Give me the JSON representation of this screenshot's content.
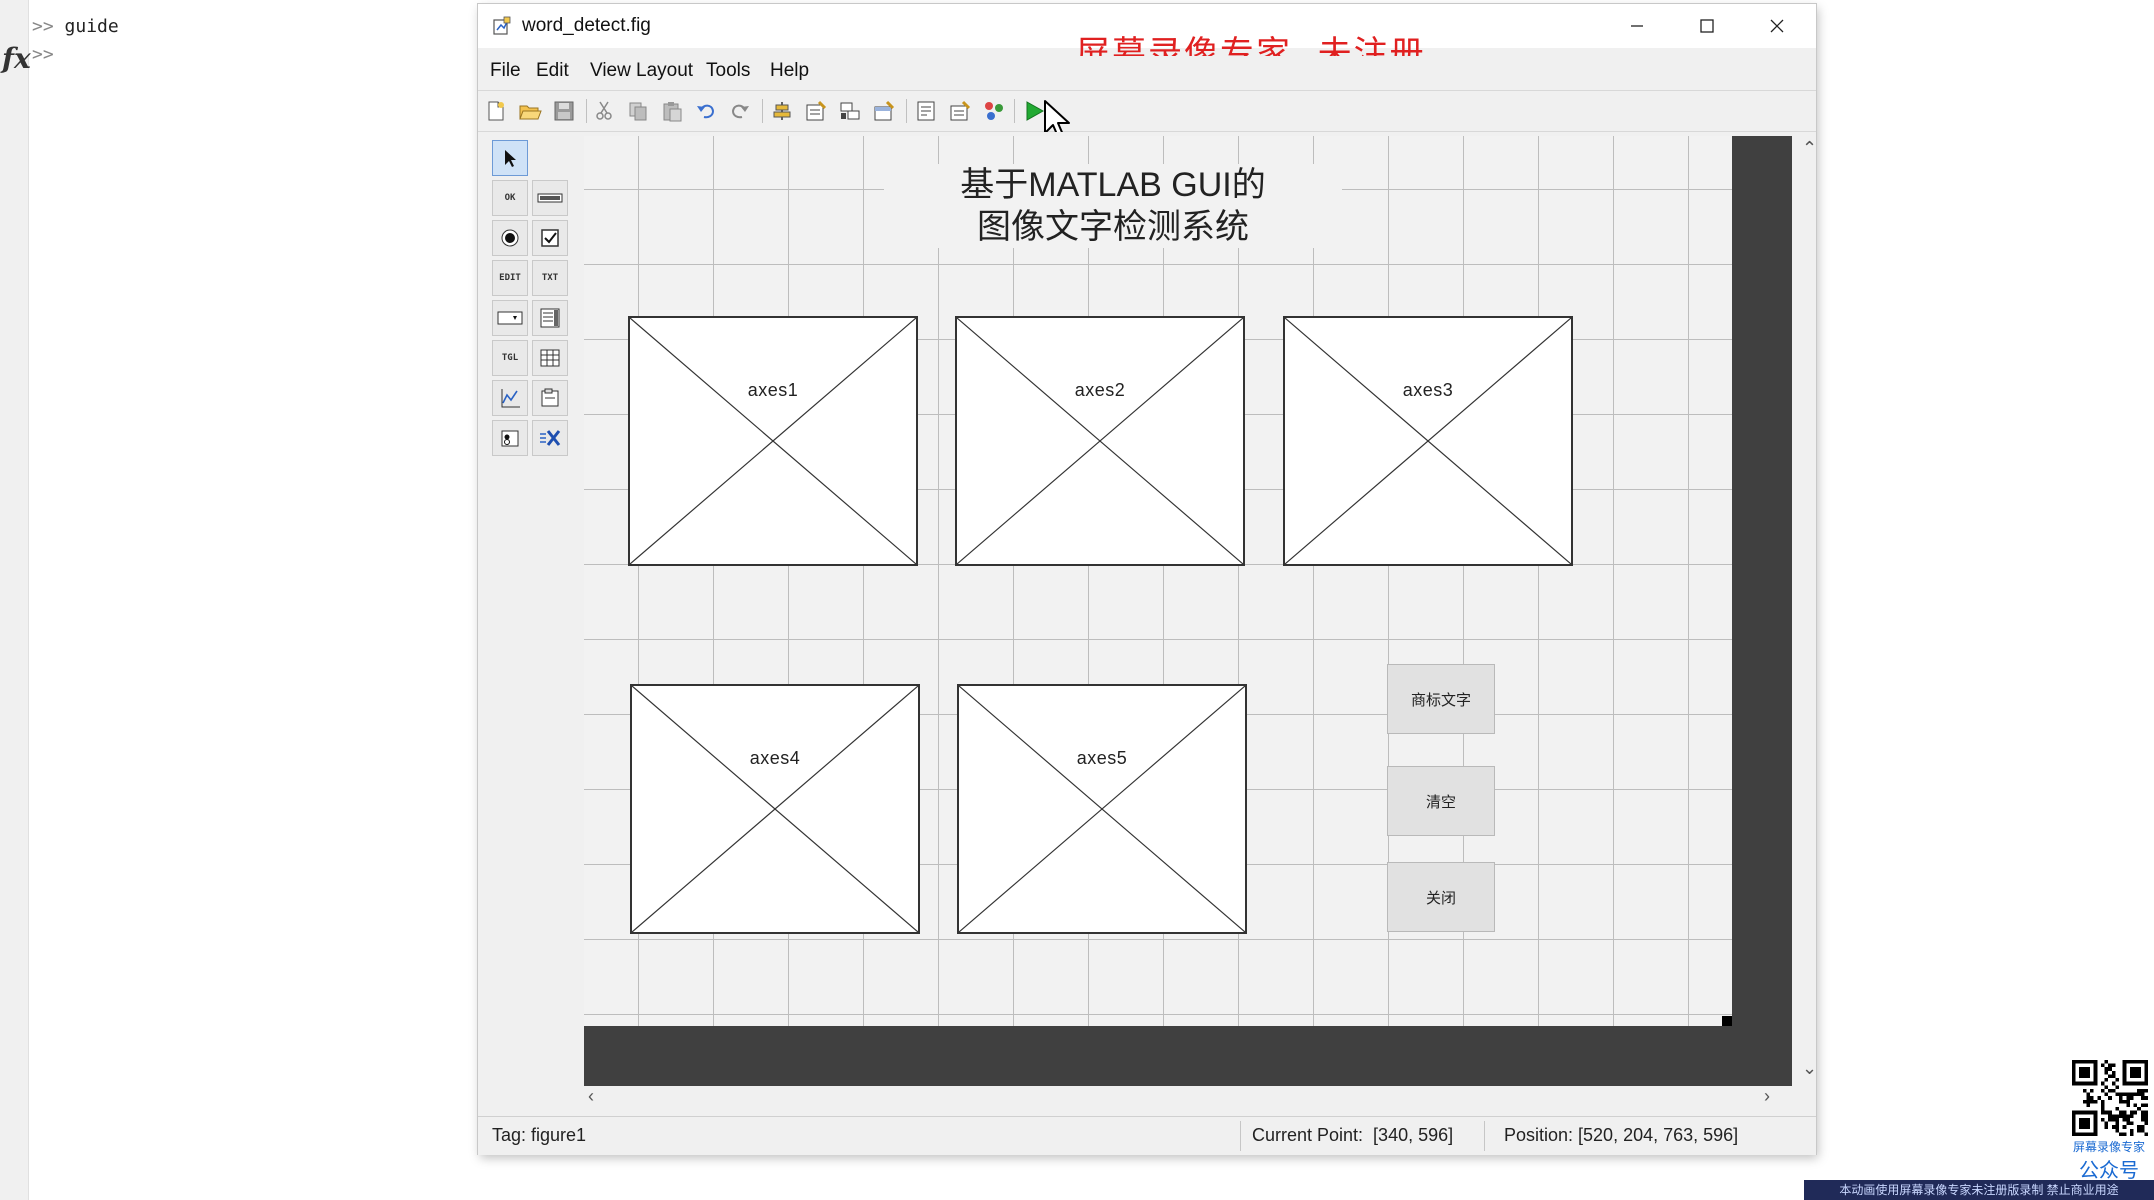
{
  "command_window": {
    "line1_prompt": ">>",
    "line1_command": "guide",
    "line2_prompt": ">>",
    "fx_symbol": "fx"
  },
  "window": {
    "title": "word_detect.fig",
    "watermark": "屏幕录像专家  未注册"
  },
  "menu": [
    "File",
    "Edit",
    "Layout",
    "View",
    "Tools",
    "Help"
  ],
  "toolbar": {
    "icons": [
      "new-file-icon",
      "open-folder-icon",
      "save-icon",
      "cut-icon",
      "copy-icon",
      "paste-icon",
      "undo-icon",
      "redo-icon",
      "align-objects-icon",
      "menu-editor-icon",
      "tab-order-icon",
      "toolbar-editor-icon",
      "editor-icon",
      "property-inspector-icon",
      "object-browser-icon",
      "run-figure-icon"
    ]
  },
  "palette": {
    "items": [
      {
        "name": "select-tool",
        "label": ""
      },
      {
        "name": "push-button-tool",
        "label": "OK"
      },
      {
        "name": "slider-tool",
        "label": ""
      },
      {
        "name": "radio-button-tool",
        "label": ""
      },
      {
        "name": "check-box-tool",
        "label": ""
      },
      {
        "name": "edit-text-tool",
        "label": "EDIT"
      },
      {
        "name": "static-text-tool",
        "label": "TXT"
      },
      {
        "name": "popup-menu-tool",
        "label": ""
      },
      {
        "name": "listbox-tool",
        "label": ""
      },
      {
        "name": "toggle-button-tool",
        "label": "TGL"
      },
      {
        "name": "table-tool",
        "label": ""
      },
      {
        "name": "axes-tool",
        "label": ""
      },
      {
        "name": "panel-tool",
        "label": ""
      },
      {
        "name": "button-group-tool",
        "label": ""
      },
      {
        "name": "activex-tool",
        "label": ""
      }
    ]
  },
  "gui": {
    "title_line1": "基于MATLAB GUI的",
    "title_line2": "图像文字检测系统",
    "axes": [
      "axes1",
      "axes2",
      "axes3",
      "axes4",
      "axes5"
    ],
    "buttons": {
      "detect": "商标文字",
      "clear": "清空",
      "close": "关闭"
    }
  },
  "status": {
    "tag": "Tag: figure1",
    "current_point": "Current Point:  [340, 596]",
    "position": "Position: [520, 204, 763, 596]"
  },
  "overlay": {
    "qr_caption1": "屏幕录像专家",
    "qr_caption2": "公众号",
    "banner": "本动画使用屏幕录像专家未注册版录制 禁止商业用途"
  },
  "colors": {
    "watermark": "#e02020",
    "run_icon": "#22aa33",
    "dark_border": "#404040"
  }
}
